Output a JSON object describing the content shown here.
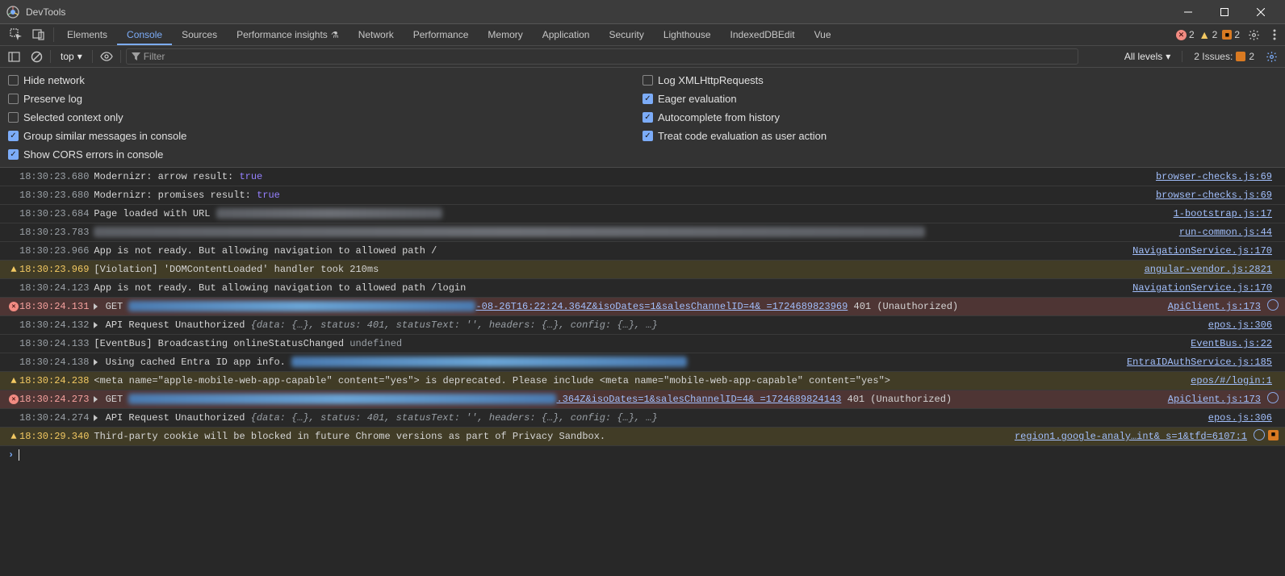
{
  "window": {
    "title": "DevTools"
  },
  "tabs": [
    "Elements",
    "Console",
    "Sources",
    "Performance insights",
    "Network",
    "Performance",
    "Memory",
    "Application",
    "Security",
    "Lighthouse",
    "IndexedDBEdit",
    "Vue"
  ],
  "activeTab": "Console",
  "statusBadges": {
    "errors": "2",
    "warnings": "2",
    "issues": "2"
  },
  "toolbar": {
    "context": "top",
    "filterPlaceholder": "Filter",
    "levelsLabel": "All levels",
    "issuesLabel": "2 Issues:",
    "issuesCount": "2"
  },
  "settings": {
    "left": [
      {
        "label": "Hide network",
        "checked": false
      },
      {
        "label": "Preserve log",
        "checked": false
      },
      {
        "label": "Selected context only",
        "checked": false
      },
      {
        "label": "Group similar messages in console",
        "checked": true
      },
      {
        "label": "Show CORS errors in console",
        "checked": true
      }
    ],
    "right": [
      {
        "label": "Log XMLHttpRequests",
        "checked": false
      },
      {
        "label": "Eager evaluation",
        "checked": true
      },
      {
        "label": "Autocomplete from history",
        "checked": true
      },
      {
        "label": "Treat code evaluation as user action",
        "checked": true
      }
    ]
  },
  "rows": [
    {
      "type": "log",
      "ts": "18:30:23.680",
      "segments": [
        {
          "t": "Modernizr:  arrow result:  "
        },
        {
          "t": "true",
          "cls": "val-true"
        }
      ],
      "loc": "browser-checks.js:69"
    },
    {
      "type": "log",
      "ts": "18:30:23.680",
      "segments": [
        {
          "t": "Modernizr:  promises result:  "
        },
        {
          "t": "true",
          "cls": "val-true"
        }
      ],
      "loc": "browser-checks.js:69"
    },
    {
      "type": "log",
      "ts": "18:30:23.684",
      "segments": [
        {
          "t": "Page loaded with URL "
        },
        {
          "blur": 280
        }
      ],
      "loc": "1-bootstrap.js:17"
    },
    {
      "type": "log",
      "ts": "18:30:23.783",
      "segments": [
        {
          "blur": 1030
        }
      ],
      "loc": "run-common.js:44"
    },
    {
      "type": "log",
      "ts": "18:30:23.966",
      "segments": [
        {
          "t": "App is not ready. But allowing navigation to allowed path /"
        }
      ],
      "loc": "NavigationService.js:170"
    },
    {
      "type": "violation",
      "ts": "18:30:23.969",
      "segments": [
        {
          "t": "[Violation] 'DOMContentLoaded' handler took 210ms"
        }
      ],
      "loc": "angular-vendor.js:2821"
    },
    {
      "type": "log",
      "ts": "18:30:24.123",
      "segments": [
        {
          "t": "App is not ready. But allowing navigation to allowed path /login"
        }
      ],
      "loc": "NavigationService.js:170"
    },
    {
      "type": "error",
      "ts": "18:30:24.131",
      "expand": true,
      "segments": [
        {
          "t": "GET "
        },
        {
          "blur": 430,
          "cls": "blue"
        },
        {
          "t": "-08-26T16:22:24.364Z&isoDates=1&salesChannelID=4& =1724689823969",
          "cls": "url-frag"
        },
        {
          "t": " 401 (Unauthorized)"
        }
      ],
      "loc": "ApiClient.js:173",
      "post": [
        "world"
      ]
    },
    {
      "type": "log",
      "ts": "18:30:24.132",
      "expand": true,
      "segments": [
        {
          "t": "API Request Unauthorized "
        },
        {
          "t": "{data: {…}, status: 401, statusText: '', headers: {…}, config: {…}, …}",
          "cls": "italic-obj"
        }
      ],
      "loc": "epos.js:306"
    },
    {
      "type": "log",
      "ts": "18:30:24.133",
      "segments": [
        {
          "t": "[EventBus] Broadcasting onlineStatusChanged "
        },
        {
          "t": "undefined",
          "cls": "val-undef"
        }
      ],
      "loc": "EventBus.js:22"
    },
    {
      "type": "log",
      "ts": "18:30:24.138",
      "expand": true,
      "segments": [
        {
          "t": "Using cached Entra ID app info. "
        },
        {
          "blur": 490,
          "cls": "blue"
        }
      ],
      "loc": "EntraIDAuthService.js:185"
    },
    {
      "type": "warning",
      "ts": "18:30:24.238",
      "segments": [
        {
          "t": "<meta name=\"apple-mobile-web-app-capable\" content=\"yes\"> is deprecated. Please include <meta name=\"mobile-web-app-capable\" content=\"yes\">"
        }
      ],
      "loc": "epos/#/login:1"
    },
    {
      "type": "error",
      "ts": "18:30:24.273",
      "expand": true,
      "segments": [
        {
          "t": "GET "
        },
        {
          "blur": 530,
          "cls": "blue"
        },
        {
          "t": ".364Z&isoDates=1&salesChannelID=4& =1724689824143",
          "cls": "url-frag"
        },
        {
          "t": " 401 (Unauthorized)"
        }
      ],
      "loc": "ApiClient.js:173",
      "post": [
        "world"
      ]
    },
    {
      "type": "log",
      "ts": "18:30:24.274",
      "expand": true,
      "segments": [
        {
          "t": "API Request Unauthorized "
        },
        {
          "t": "{data: {…}, status: 401, statusText: '', headers: {…}, config: {…}, …}",
          "cls": "italic-obj"
        }
      ],
      "loc": "epos.js:306"
    },
    {
      "type": "warning",
      "ts": "18:30:29.340",
      "segments": [
        {
          "t": "Third-party cookie will be blocked in future Chrome versions as part of Privacy Sandbox."
        }
      ],
      "loc": "region1.google-analy…int& s=1&tfd=6107:1",
      "post": [
        "world",
        "issue"
      ]
    }
  ]
}
